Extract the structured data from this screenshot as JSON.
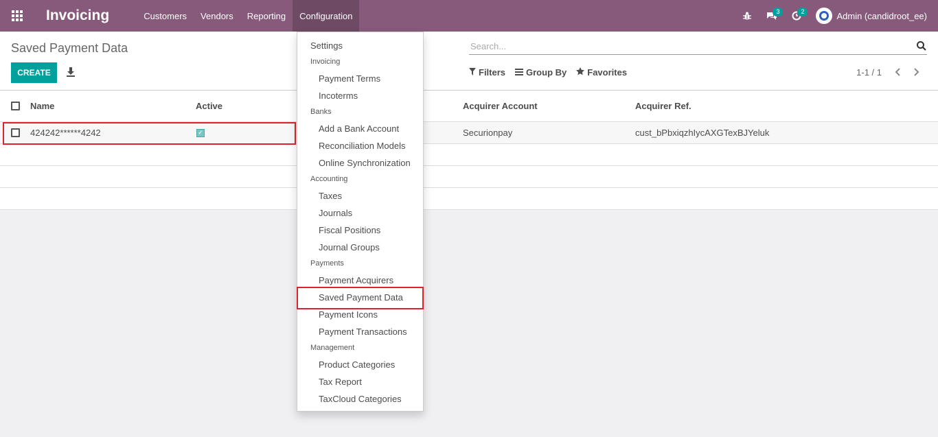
{
  "navbar": {
    "brand": "Invoicing",
    "menu": [
      "Customers",
      "Vendors",
      "Reporting",
      "Configuration"
    ],
    "messages_count": "3",
    "activities_count": "2",
    "user": "Admin (candidroot_ee)",
    "color": "#875a7b"
  },
  "control_panel": {
    "title": "Saved Payment Data",
    "create_label": "CREATE",
    "search_placeholder": "Search...",
    "filters_label": "Filters",
    "group_by_label": "Group By",
    "favorites_label": "Favorites",
    "pager": "1-1 / 1"
  },
  "list": {
    "columns": [
      "Name",
      "Active",
      "Acquirer Account",
      "Acquirer Ref."
    ],
    "rows": [
      {
        "name": "424242******4242",
        "active": true,
        "acquirer_account": "Securionpay",
        "acquirer_ref": "cust_bPbxiqzhIycAXGTexBJYeluk"
      }
    ]
  },
  "dropdown": {
    "settings": "Settings",
    "sections": [
      {
        "header": "Invoicing",
        "items": [
          "Payment Terms",
          "Incoterms"
        ]
      },
      {
        "header": "Banks",
        "items": [
          "Add a Bank Account",
          "Reconciliation Models",
          "Online Synchronization"
        ]
      },
      {
        "header": "Accounting",
        "items": [
          "Taxes",
          "Journals",
          "Fiscal Positions",
          "Journal Groups"
        ]
      },
      {
        "header": "Payments",
        "items": [
          "Payment Acquirers",
          "Saved Payment Data",
          "Payment Icons",
          "Payment Transactions"
        ]
      },
      {
        "header": "Management",
        "items": [
          "Product Categories",
          "Tax Report",
          "TaxCloud Categories"
        ]
      }
    ]
  },
  "colors": {
    "accent": "#00a09d",
    "highlight": "#d9232d"
  }
}
